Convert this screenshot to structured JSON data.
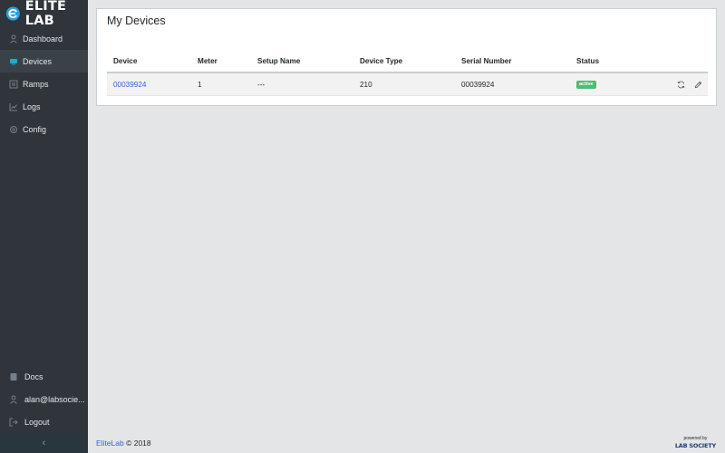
{
  "brand": {
    "name": "ELITE LAB",
    "accent": "#2e9fe0"
  },
  "sidebar": {
    "items": [
      {
        "label": "Dashboard",
        "icon": "speedometer-icon"
      },
      {
        "label": "Devices",
        "icon": "devices-icon",
        "active": true
      },
      {
        "label": "Ramps",
        "icon": "list-icon"
      },
      {
        "label": "Logs",
        "icon": "chart-icon"
      },
      {
        "label": "Config",
        "icon": "gear-icon"
      }
    ],
    "bottom_items": [
      {
        "label": "Docs",
        "icon": "docs-icon"
      },
      {
        "label": "alan@labsocie...",
        "icon": "user-icon"
      },
      {
        "label": "Logout",
        "icon": "logout-icon"
      }
    ],
    "minimizer": "‹"
  },
  "main": {
    "title": "My Devices",
    "table": {
      "columns": [
        "Device",
        "Meter",
        "Setup Name",
        "Device Type",
        "Serial Number",
        "Status"
      ],
      "rows": [
        {
          "device": "00039924",
          "meter": "1",
          "setup_name": "---",
          "device_type": "210",
          "serial_number": "00039924",
          "status": "active"
        }
      ]
    }
  },
  "footer": {
    "brand_link": "EliteLab",
    "copyright": "© 2018",
    "powered_by": "powered by",
    "powered_logo": "LAB SOCIETY"
  },
  "colors": {
    "sidebar_bg": "#2f353a",
    "link": "#3d5fd1",
    "status_active": "#4dbd74"
  }
}
